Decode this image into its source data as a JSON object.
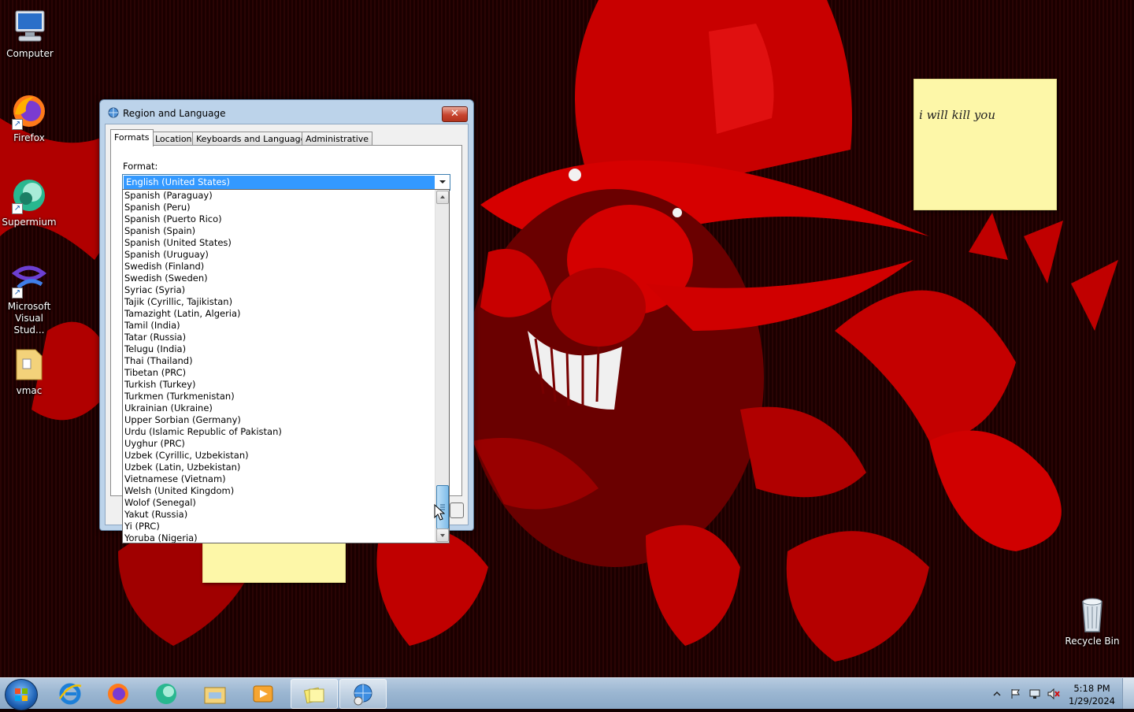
{
  "desktop": {
    "icons": [
      {
        "label": "Computer"
      },
      {
        "label": "Firefox"
      },
      {
        "label": "Supermium"
      },
      {
        "label": "Microsoft Visual Stud..."
      },
      {
        "label": "vmac"
      },
      {
        "label": "Recycle Bin"
      }
    ],
    "sticky_note_text": "i will kill you"
  },
  "dialog": {
    "title": "Region and Language",
    "close_glyph": "✕",
    "tabs": [
      "Formats",
      "Location",
      "Keyboards and Languages",
      "Administrative"
    ],
    "active_tab": "Formats",
    "format_label": "Format:",
    "format_value": "English (United States)"
  },
  "dropdown": {
    "items": [
      "Spanish (Paraguay)",
      "Spanish (Peru)",
      "Spanish (Puerto Rico)",
      "Spanish (Spain)",
      "Spanish (United States)",
      "Spanish (Uruguay)",
      "Swedish (Finland)",
      "Swedish (Sweden)",
      "Syriac (Syria)",
      "Tajik (Cyrillic, Tajikistan)",
      "Tamazight (Latin, Algeria)",
      "Tamil (India)",
      "Tatar (Russia)",
      "Telugu (India)",
      "Thai (Thailand)",
      "Tibetan (PRC)",
      "Turkish (Turkey)",
      "Turkmen (Turkmenistan)",
      "Ukrainian (Ukraine)",
      "Upper Sorbian (Germany)",
      "Urdu (Islamic Republic of Pakistan)",
      "Uyghur (PRC)",
      "Uzbek (Cyrillic, Uzbekistan)",
      "Uzbek (Latin, Uzbekistan)",
      "Vietnamese (Vietnam)",
      "Welsh (United Kingdom)",
      "Wolof (Senegal)",
      "Yakut (Russia)",
      "Yi (PRC)",
      "Yoruba (Nigeria)"
    ],
    "scroll_position": 1.0
  },
  "taskbar": {
    "pinned": [
      "start-orb",
      "internet-explorer-icon",
      "firefox-icon",
      "supermium-icon",
      "file-explorer-icon",
      "media-player-icon",
      "sticky-notes-icon",
      "region-language-icon"
    ],
    "time": "5:18 PM",
    "date": "1/29/2024"
  },
  "colors": {
    "selection": "#3399ff",
    "wallpaper_red": "#d00000",
    "sticky_yellow": "#fdf7a8"
  }
}
